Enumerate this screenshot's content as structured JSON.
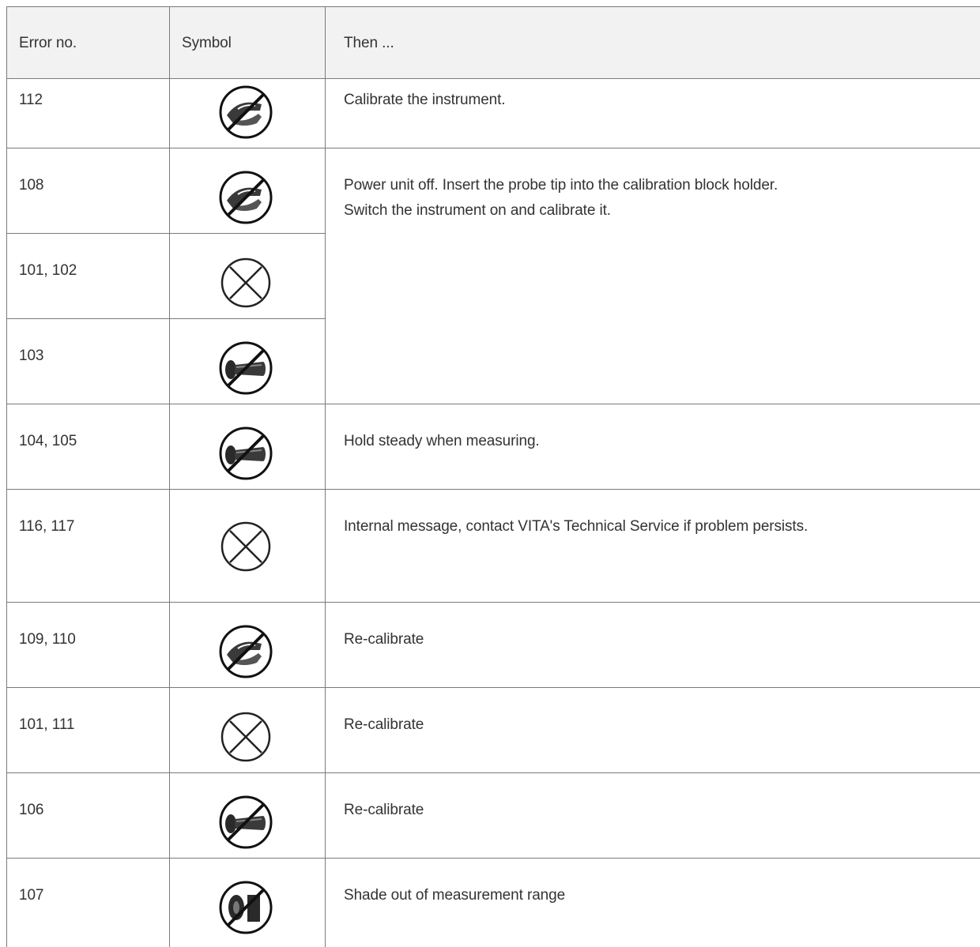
{
  "table": {
    "headers": {
      "error_no": "Error no.",
      "symbol": "Symbol",
      "then": "Then ..."
    },
    "rows": [
      {
        "error": "112",
        "symbol": "calibration-probe-crossed-icon",
        "action": "Calibrate the instrument."
      },
      {
        "error": "108",
        "symbol": "calibration-probe-crossed-icon",
        "action": "Power unit off. Insert the probe tip into the calibration block holder."
      },
      {
        "error": "101, 102",
        "symbol": "crossed-circle-icon",
        "action": "Switch the instrument on and calibrate it."
      },
      {
        "error": "103",
        "symbol": "handpiece-crossed-icon",
        "action": ""
      },
      {
        "error": "104, 105",
        "symbol": "handpiece-crossed-icon",
        "action": "Hold steady when measuring."
      },
      {
        "error": "116, 117",
        "symbol": "crossed-circle-icon",
        "action": "Internal message, contact VITA's Technical Service if problem persists."
      },
      {
        "error": "109, 110",
        "symbol": "calibration-probe-crossed-icon",
        "action": "Re-calibrate"
      },
      {
        "error": "101, 111",
        "symbol": "crossed-circle-icon",
        "action": "Re-calibrate"
      },
      {
        "error": "106",
        "symbol": "handpiece-crossed-icon",
        "action": "Re-calibrate"
      },
      {
        "error": "107",
        "symbol": "shade-out-of-range-icon",
        "action": "Shade out of measurement range"
      }
    ]
  }
}
